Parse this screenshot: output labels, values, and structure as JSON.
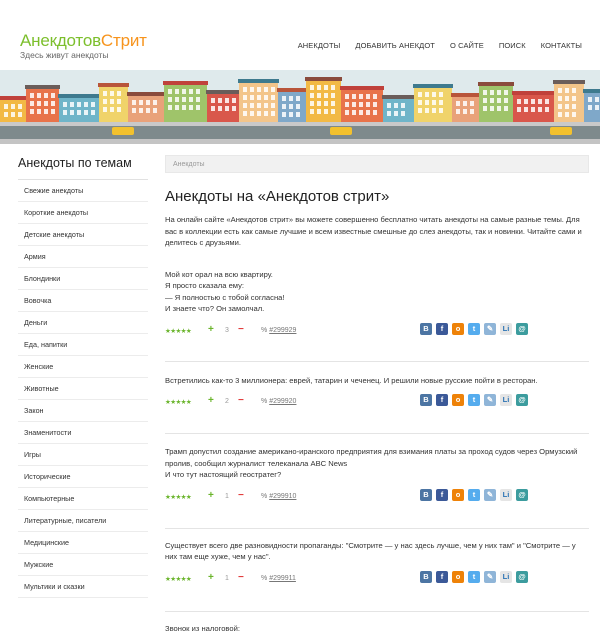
{
  "site": {
    "logo_part1": "Анекдотов",
    "logo_part2": "Стрит",
    "tagline": "Здесь живут анекдоты"
  },
  "nav": [
    "АНЕКДОТЫ",
    "ДОБАВИТЬ АНЕКДОТ",
    "О САЙТЕ",
    "ПОИСК",
    "КОНТАКТЫ"
  ],
  "sidebar": {
    "title": "Анекдоты по темам",
    "items": [
      "Свежие анекдоты",
      "Короткие анекдоты",
      "Детские анекдоты",
      "Армия",
      "Блондинки",
      "Вовочка",
      "Деньги",
      "Еда, напитки",
      "Женские",
      "Животные",
      "Закон",
      "Знаменитости",
      "Игры",
      "Исторические",
      "Компьютерные",
      "Литературные, писатели",
      "Медицинские",
      "Мужские",
      "Мультики и сказки"
    ]
  },
  "breadcrumb": "Анекдоты",
  "page_title": "Анекдоты на «Анекдотов стрит»",
  "intro": "На онлайн сайте «Анекдотов стрит» вы можете совершенно бесплатно читать анекдоты на самые разные темы. Для вас в коллекции есть как самые лучшие и всем известные смешные до слез анекдоты, так и новинки. Читайте сами и делитесь с друзьями.",
  "jokes": [
    {
      "text": "Мой кот орал на всю квартиру.\nЯ просто сказала ему:\n— Я полностью с тобой согласна!\nИ знаете что? Он замолчал.",
      "stars": "★★★★★",
      "votes": "3",
      "link": "#299929"
    },
    {
      "text": "Встретились как-то 3 миллионера: еврей, татарин и чеченец. И решили новые русские пойти в ресторан.",
      "stars": "★★★★★",
      "votes": "2",
      "link": "#299920"
    },
    {
      "text": "Трамп допустил создание американо-иранского предприятия для взимания платы за проход судов через Ормузский пролив, сообщил журналист телеканала ABC News\nИ что тут настоящий геостратег?",
      "stars": "★★★★★",
      "votes": "1",
      "link": "#299910"
    },
    {
      "text": "Существует всего две разновидности пропаганды: \"Смотрите — у нас здесь лучше, чем у них там\" и \"Смотрите — у них там еще хуже, чем у нас\".",
      "stars": "★★★★★",
      "votes": "1",
      "link": "#299911"
    },
    {
      "text": "Звонок из налоговой:",
      "stars": "",
      "votes": "",
      "link": ""
    }
  ],
  "ui": {
    "plus": "+",
    "minus": "−",
    "link_icon": "%"
  },
  "share_icons": [
    "vk-icon",
    "facebook-icon",
    "odnoklassniki-icon",
    "twitter-icon",
    "livejournal-icon",
    "liveinternet-icon",
    "mailru-icon"
  ],
  "colors": {
    "logo_green": "#7cbf2c",
    "logo_orange": "#f7941d",
    "star_green": "#6ab42b",
    "minus_red": "#e23a3a"
  }
}
